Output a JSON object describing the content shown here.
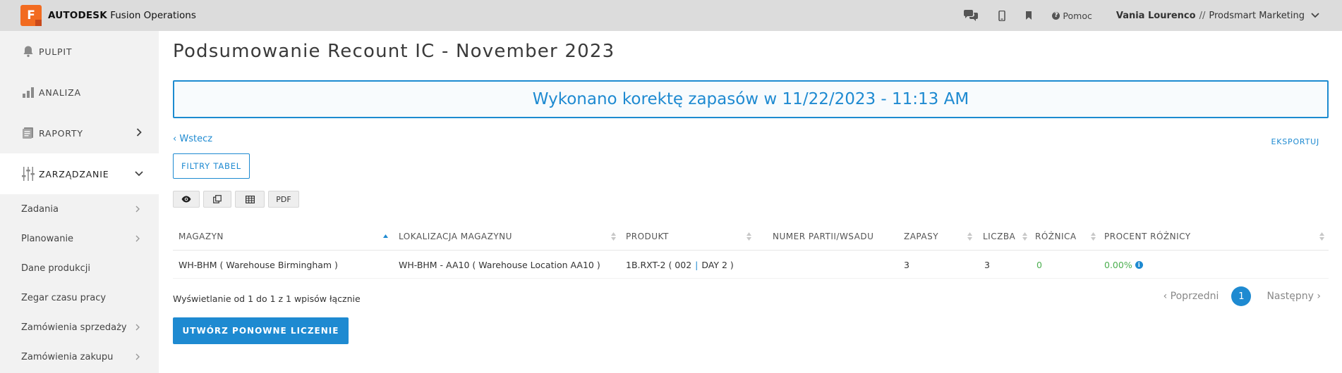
{
  "app": {
    "logo_letter": "F",
    "brand_bold": "AUTODESK",
    "brand_rest": "Fusion Operations",
    "help_label": "Pomoc",
    "user_name": "Vania Lourenco",
    "user_sep": "//",
    "org_name": "Prodsmart Marketing"
  },
  "sidebar": {
    "main_items": [
      {
        "label": "PULPIT",
        "icon": "bell-icon"
      },
      {
        "label": "ANALIZA",
        "icon": "bar-chart-icon"
      },
      {
        "label": "RAPORTY",
        "icon": "reports-icon"
      },
      {
        "label": "ZARZĄDZANIE",
        "icon": "sliders-icon"
      }
    ],
    "sub_items": [
      {
        "label": "Zadania"
      },
      {
        "label": "Planowanie"
      },
      {
        "label": "Dane produkcji"
      },
      {
        "label": "Zegar czasu pracy"
      },
      {
        "label": "Zamówienia sprzedaży"
      },
      {
        "label": "Zamówienia zakupu"
      }
    ]
  },
  "page": {
    "title": "Podsumowanie Recount IC - November 2023",
    "banner": "Wykonano korektę zapasów w 11/22/2023 - 11:13 AM",
    "back_label": "Wstecz",
    "export_label": "EKSPORTUJ",
    "filter_label": "FILTRY TABEL",
    "pdf_label": "PDF",
    "summary": "Wyświetlanie od 1 do 1 z 1 wpisów łącznie",
    "prev_label": "Poprzedni",
    "current_page": "1",
    "next_label": "Następny",
    "create_label": "UTWÓRZ PONOWNE LICZENIE"
  },
  "table": {
    "headers": [
      "MAGAZYN",
      "LOKALIZACJA MAGAZYNU",
      "PRODUKT",
      "NUMER PARTII/WSADU",
      "ZAPASY",
      "LICZBA",
      "RÓŻNICA",
      "PROCENT RÓŻNICY"
    ],
    "rows": [
      {
        "magazyn": "WH-BHM ( Warehouse Birmingham )",
        "lokalizacja": "WH-BHM - AA10 ( Warehouse Location AA10 )",
        "produkt_code": "1B.RXT-2 ( 002",
        "produkt_sep": "|",
        "produkt_day": "DAY 2 )",
        "partia": "",
        "zapasy": "3",
        "liczba": "3",
        "roznica": "0",
        "procent": "0.00%"
      }
    ]
  },
  "colors": {
    "accent": "#1e8ad1",
    "logo": "#f26b20",
    "topbar": "#dcdcdc",
    "sidebar": "#f2f2f2",
    "positive": "#4caf50"
  }
}
